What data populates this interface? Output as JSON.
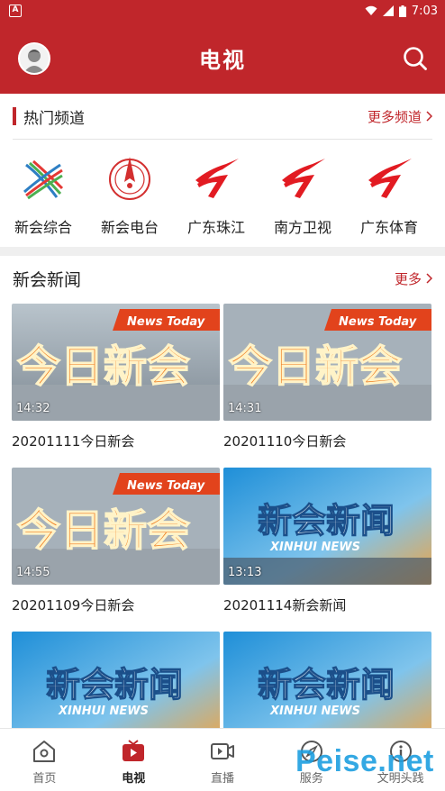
{
  "status_bar": {
    "time": "7:03"
  },
  "header": {
    "title": "电视"
  },
  "hot_channels": {
    "title": "热门频道",
    "more_label": "更多频道",
    "items": [
      {
        "label": "新会综合",
        "icon": "xinhui-general-logo-icon"
      },
      {
        "label": "新会电台",
        "icon": "xinhui-radio-logo-icon"
      },
      {
        "label": "广东珠江",
        "icon": "guangdong-tv-logo-icon"
      },
      {
        "label": "南方卫视",
        "icon": "guangdong-tv-logo-icon"
      },
      {
        "label": "广东体育",
        "icon": "guangdong-tv-logo-icon"
      }
    ]
  },
  "news": {
    "title": "新会新闻",
    "more_label": "更多",
    "items": [
      {
        "title": "20201111今日新会",
        "duration": "14:32",
        "thumb": "today-xinhui"
      },
      {
        "title": "20201110今日新会",
        "duration": "14:31",
        "thumb": "today-xinhui"
      },
      {
        "title": "20201109今日新会",
        "duration": "14:55",
        "thumb": "today-xinhui"
      },
      {
        "title": "20201114新会新闻",
        "duration": "13:13",
        "thumb": "xinhui-news"
      },
      {
        "title": "",
        "duration": "",
        "thumb": "xinhui-news"
      },
      {
        "title": "",
        "duration": "",
        "thumb": "xinhui-news"
      }
    ],
    "thumb_text": {
      "today_banner": "News Today",
      "today_title": "今日新会",
      "news_title": "新会新闻",
      "news_subtitle": "XINHUI NEWS"
    }
  },
  "tabbar": {
    "items": [
      {
        "label": "首页",
        "icon": "home-icon",
        "active": false
      },
      {
        "label": "电视",
        "icon": "tv-icon",
        "active": true
      },
      {
        "label": "直播",
        "icon": "live-video-icon",
        "active": false
      },
      {
        "label": "服务",
        "icon": "compass-icon",
        "active": false
      },
      {
        "label": "文明头践",
        "icon": "info-icon",
        "active": false
      }
    ]
  },
  "watermark": "Peise.net",
  "colors": {
    "brand_red": "#c0262b",
    "background_gray": "#efefef"
  }
}
